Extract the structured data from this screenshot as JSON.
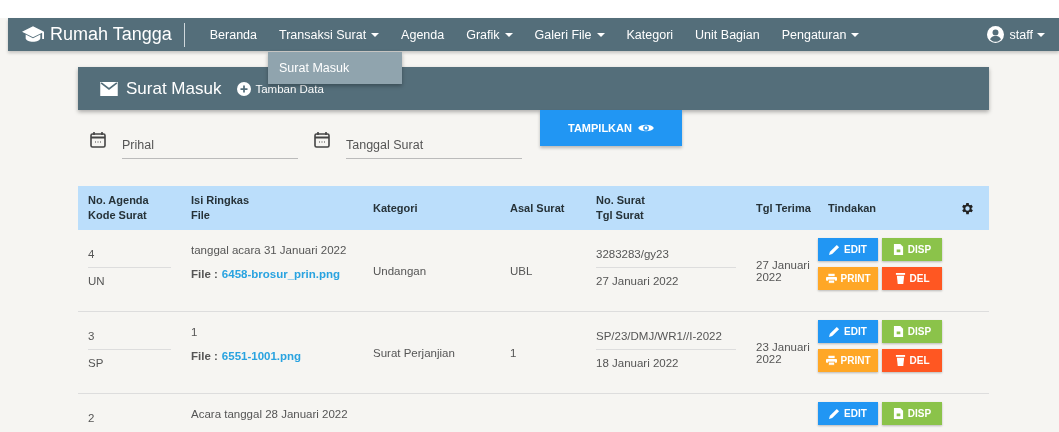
{
  "navbar": {
    "brand": "Rumah Tangga",
    "items": [
      {
        "label": "Beranda",
        "dropdown": false
      },
      {
        "label": "Transaksi Surat",
        "dropdown": true,
        "menu": [
          "Surat Masuk"
        ]
      },
      {
        "label": "Agenda",
        "dropdown": false
      },
      {
        "label": "Grafik",
        "dropdown": true
      },
      {
        "label": "Galeri File",
        "dropdown": true
      },
      {
        "label": "Kategori",
        "dropdown": false
      },
      {
        "label": "Unit Bagian",
        "dropdown": false
      },
      {
        "label": "Pengaturan",
        "dropdown": true
      }
    ],
    "user": "staff"
  },
  "panel": {
    "title": "Surat Masuk",
    "add_label": "Tamban Data"
  },
  "filters": [
    {
      "placeholder": "Prihal"
    },
    {
      "placeholder": "Tanggal Surat"
    }
  ],
  "show_button": "TAMPILKAN",
  "table": {
    "columns": [
      {
        "lines": [
          "No. Agenda",
          "Kode Surat"
        ]
      },
      {
        "lines": [
          "Isi Ringkas",
          "File"
        ]
      },
      {
        "lines": [
          "Kategori"
        ]
      },
      {
        "lines": [
          "Asal Surat"
        ]
      },
      {
        "lines": [
          "No. Surat",
          "Tgl Surat"
        ]
      },
      {
        "lines": [
          "Tgl Terima"
        ]
      },
      {
        "lines": [
          "Tindakan"
        ]
      }
    ],
    "rows": [
      {
        "agenda": "4",
        "kode": "UN",
        "isi": "tanggal acara 31 Januari 2022",
        "file_label": "File :",
        "file": "6458-brosur_prin.png",
        "kategori": "Undangan",
        "asal": "UBL",
        "no_surat": "3283283/gy23",
        "tgl_surat": "27 Januari 2022",
        "tgl_terima": "27 Januari 2022",
        "actions": [
          {
            "label": "EDIT",
            "kind": "edit"
          },
          {
            "label": "DISP",
            "kind": "disp"
          },
          {
            "label": "PRINT",
            "kind": "print"
          },
          {
            "label": "DEL",
            "kind": "del"
          }
        ]
      },
      {
        "agenda": "3",
        "kode": "SP",
        "isi": "1",
        "file_label": "File :",
        "file": "6551-1001.png",
        "kategori": "Surat Perjanjian",
        "asal": "1",
        "no_surat": "SP/23/DMJ/WR1//I-2022",
        "tgl_surat": "18 Januari 2022",
        "tgl_terima": "23 Januari 2022",
        "actions": [
          {
            "label": "EDIT",
            "kind": "edit"
          },
          {
            "label": "DISP",
            "kind": "disp"
          },
          {
            "label": "PRINT",
            "kind": "print"
          },
          {
            "label": "DEL",
            "kind": "del"
          }
        ]
      },
      {
        "agenda": "2",
        "isi": "Acara tanggal 28 Januari 2022",
        "actions": [
          {
            "label": "EDIT",
            "kind": "edit"
          },
          {
            "label": "DISP",
            "kind": "disp"
          }
        ]
      }
    ]
  }
}
